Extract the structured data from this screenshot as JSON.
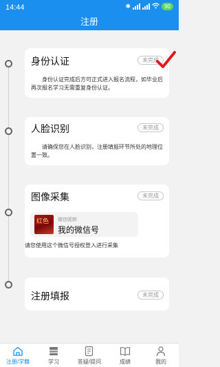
{
  "status_bar": {
    "time": "14:44",
    "battery": "90"
  },
  "header": {
    "title": "注册"
  },
  "steps": [
    {
      "title": "身份认证",
      "status": "未完成",
      "desc": "身份认证完成后方可正式进入报名流程，如毕业后再次报名学习无需重复身份认证。"
    },
    {
      "title": "人脸识别",
      "status": "未完成",
      "desc": "请确保您在人脸识别，注册填报环节所处的地理位置一致。"
    },
    {
      "title": "图像采集",
      "status": "未完成",
      "wechat_caption": "微信昵称",
      "wechat_name": "我的微信号",
      "note": "请您使用这个微信号授权登入进行采集"
    },
    {
      "title": "注册填报",
      "status": "未完成"
    }
  ],
  "avatar_text": "红色",
  "nav": [
    {
      "label": "注册/学籍",
      "icon": "home-icon"
    },
    {
      "label": "学习",
      "icon": "book-stack-icon"
    },
    {
      "label": "答疑/提问",
      "icon": "edit-icon"
    },
    {
      "label": "成绩",
      "icon": "open-book-icon"
    },
    {
      "label": "我的",
      "icon": "person-icon"
    }
  ],
  "colors": {
    "accent": "#1a8ff0",
    "check": "#e0191c",
    "battery": "#5cd65c"
  }
}
